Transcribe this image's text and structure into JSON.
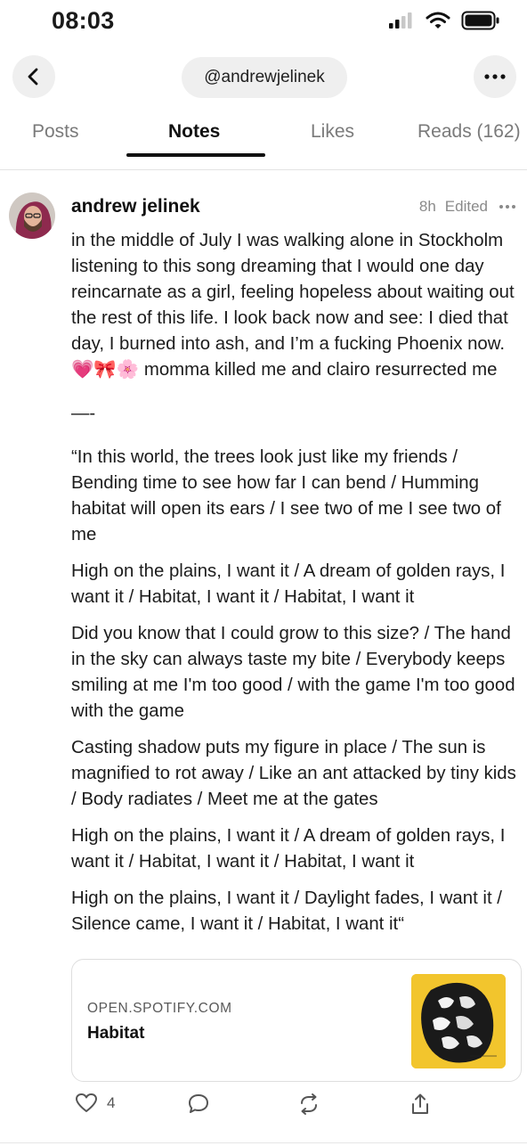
{
  "status": {
    "time": "08:03"
  },
  "header": {
    "handle": "@andrewjelinek"
  },
  "tabs": [
    {
      "label": "Posts"
    },
    {
      "label": "Notes"
    },
    {
      "label": "Likes"
    },
    {
      "label": "Reads (162)"
    }
  ],
  "note": {
    "author": "andrew jelinek",
    "time": "8h",
    "edited": "Edited",
    "paragraphs": [
      "in the middle of July I was walking alone in Stockholm listening to this song dreaming that I would one day reincarnate as a girl, feeling hopeless about waiting out the rest of this life. I look back now and see: I died that day, I burned into ash, and I’m a fucking Phoenix now. 💗🎀🌸 momma killed me and clairo resurrected me",
      "—-",
      "“In this world, the trees look just like my friends / Bending time to see how far I can bend / Humming habitat will open its ears / I see two of me I see two of me",
      "High on the plains, I want it / A dream of golden rays, I want it  / Habitat, I want it  / Habitat, I want it",
      "Did you know that I could grow to this size?   / The hand in the sky can always taste my bite / Everybody keeps smiling at me I'm too good / with the game I'm too good with the game",
      "Casting shadow puts my figure in place / The sun is magnified to rot away / Like an ant attacked by tiny kids / Body radiates / Meet me at the gates",
      "High on the plains, I want it / A dream of golden rays, I want it / Habitat, I want it / Habitat, I want it",
      "High on the plains, I want it / Daylight fades, I want it / Silence came, I want it / Habitat, I want it“"
    ],
    "link": {
      "domain": "OPEN.SPOTIFY.COM",
      "title": "Habitat"
    },
    "actions": {
      "likes": "4"
    }
  },
  "icons": {
    "back": "chevron-left-icon",
    "more": "ellipsis-icon",
    "like": "heart-icon",
    "comment": "comment-icon",
    "restack": "restack-icon",
    "share": "share-icon"
  },
  "colors": {
    "accent": "#111111",
    "pill_bg": "#efefef",
    "album_bg": "#f2c52d"
  }
}
